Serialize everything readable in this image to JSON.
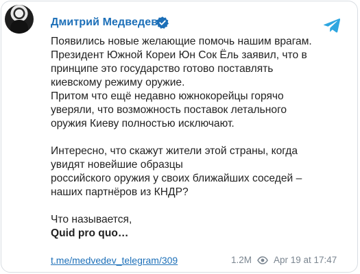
{
  "post": {
    "author": "Дмитрий Медведев",
    "lines": [
      "Появились новые желающие помочь нашим врагам.",
      "Президент Южной Кореи Юн Сок Ёль заявил, что в",
      "принципе это государство готово поставлять",
      "киевскому режиму оружие.",
      "Притом что ещё недавно южнокорейцы горячо",
      "уверяли, что возможность поставок летального",
      "оружия Киеву полностью исключают.",
      "",
      "Интересно, что скажут жители этой страны, когда",
      "увидят новейшие образцы",
      "российского оружия у своих ближайших соседей –",
      "наших партнёров из КНДР?",
      "",
      "Что называется,",
      "Quid pro quo…"
    ],
    "link": "t.me/medvedev_telegram/309",
    "views": "1.2M",
    "date": "Apr 19 at 17:47"
  },
  "icons": {
    "verified": "verified-badge-icon",
    "telegram": "telegram-logo-icon",
    "views": "eye-icon"
  },
  "colors": {
    "accent": "#1c6fb8",
    "telegram": "#2ea6e0",
    "text": "#222222",
    "muted": "#7a8590"
  }
}
